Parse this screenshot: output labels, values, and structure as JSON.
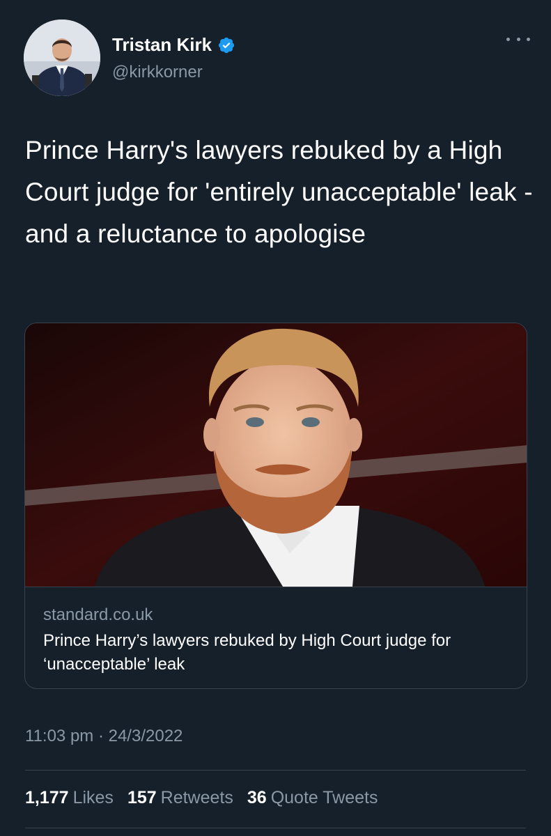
{
  "author": {
    "display_name": "Tristan Kirk",
    "handle": "@kirkkorner",
    "verified": true,
    "avatar_icon": "avatar-photo-man-in-suit"
  },
  "tweet": {
    "text": "Prince Harry's lawyers rebuked by a High Court judge for 'entirely unacceptable' leak - and a reluctance to apologise",
    "timestamp": "11:03 pm · 24/3/2022"
  },
  "link_card": {
    "domain": "standard.co.uk",
    "title": "Prince Harry’s lawyers rebuked by High Court judge for ‘unacceptable’ leak",
    "image_icon": "photo-man-red-beard-dark-suit"
  },
  "stats": {
    "likes_count": "1,177",
    "likes_label": "Likes",
    "retweets_count": "157",
    "retweets_label": "Retweets",
    "quotes_count": "36",
    "quotes_label": "Quote Tweets"
  },
  "colors": {
    "background": "#15202b",
    "secondary_text": "#8b98a5",
    "border": "#38444d",
    "verified_blue": "#1d9bf0"
  }
}
